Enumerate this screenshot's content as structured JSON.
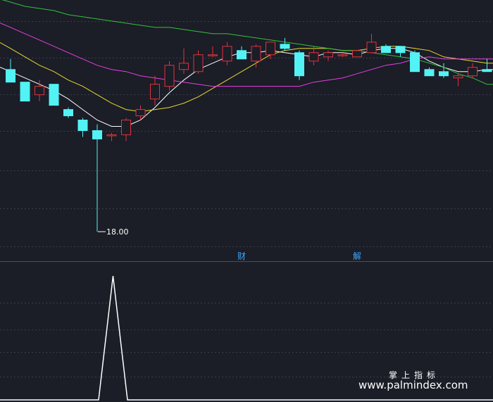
{
  "chart_data": [
    {
      "type": "candlestick",
      "panel": "price",
      "ylim": [
        17.3,
        29.0
      ],
      "grid": true,
      "up_color": "#e0343c",
      "down_color": "#53f2f4",
      "candles": [
        {
          "o": 25.7,
          "h": 26.2,
          "l": 25.1,
          "c": 25.1
        },
        {
          "o": 25.1,
          "h": 25.1,
          "l": 24.2,
          "c": 24.2
        },
        {
          "o": 24.5,
          "h": 25.2,
          "l": 24.2,
          "c": 24.9
        },
        {
          "o": 25.0,
          "h": 25.0,
          "l": 24.0,
          "c": 24.0
        },
        {
          "o": 23.8,
          "h": 23.9,
          "l": 23.4,
          "c": 23.5
        },
        {
          "o": 23.3,
          "h": 23.4,
          "l": 22.5,
          "c": 22.8
        },
        {
          "o": 22.8,
          "h": 23.1,
          "l": 18.0,
          "c": 22.4
        },
        {
          "o": 22.6,
          "h": 22.7,
          "l": 22.3,
          "c": 22.6
        },
        {
          "o": 22.6,
          "h": 23.4,
          "l": 22.3,
          "c": 23.3
        },
        {
          "o": 23.5,
          "h": 24.0,
          "l": 23.3,
          "c": 23.8
        },
        {
          "o": 24.3,
          "h": 25.4,
          "l": 24.0,
          "c": 25.0
        },
        {
          "o": 24.9,
          "h": 26.1,
          "l": 24.7,
          "c": 25.9
        },
        {
          "o": 25.7,
          "h": 26.7,
          "l": 25.5,
          "c": 26.0
        },
        {
          "o": 25.6,
          "h": 26.6,
          "l": 25.5,
          "c": 26.4
        },
        {
          "o": 26.4,
          "h": 26.8,
          "l": 26.3,
          "c": 26.4
        },
        {
          "o": 26.1,
          "h": 27.0,
          "l": 25.9,
          "c": 26.8
        },
        {
          "o": 26.6,
          "h": 26.8,
          "l": 26.2,
          "c": 26.2
        },
        {
          "o": 26.1,
          "h": 26.9,
          "l": 25.8,
          "c": 26.8
        },
        {
          "o": 26.4,
          "h": 27.0,
          "l": 26.2,
          "c": 27.0
        },
        {
          "o": 26.9,
          "h": 27.2,
          "l": 26.6,
          "c": 26.7
        },
        {
          "o": 26.5,
          "h": 26.6,
          "l": 25.2,
          "c": 25.4
        },
        {
          "o": 26.1,
          "h": 26.8,
          "l": 25.9,
          "c": 26.5
        },
        {
          "o": 26.3,
          "h": 26.6,
          "l": 26.1,
          "c": 26.5
        },
        {
          "o": 26.4,
          "h": 26.5,
          "l": 26.3,
          "c": 26.4
        },
        {
          "o": 26.3,
          "h": 26.6,
          "l": 26.3,
          "c": 26.6
        },
        {
          "o": 26.5,
          "h": 27.4,
          "l": 26.5,
          "c": 27.0
        },
        {
          "o": 26.8,
          "h": 26.9,
          "l": 26.5,
          "c": 26.5
        },
        {
          "o": 26.8,
          "h": 26.8,
          "l": 26.3,
          "c": 26.5
        },
        {
          "o": 26.5,
          "h": 26.6,
          "l": 25.6,
          "c": 25.6
        },
        {
          "o": 25.7,
          "h": 25.8,
          "l": 25.4,
          "c": 25.4
        },
        {
          "o": 25.6,
          "h": 26.0,
          "l": 25.3,
          "c": 25.4
        },
        {
          "o": 25.3,
          "h": 25.5,
          "l": 24.9,
          "c": 25.4
        },
        {
          "o": 25.4,
          "h": 26.0,
          "l": 25.3,
          "c": 25.8
        },
        {
          "o": 25.7,
          "h": 26.2,
          "l": 25.6,
          "c": 25.6
        }
      ],
      "ma_lines": [
        {
          "color": "#ffffff",
          "values": [
            25.6,
            25.3,
            25.0,
            24.7,
            24.3,
            23.8,
            23.3,
            23.0,
            23.0,
            23.3,
            23.9,
            24.6,
            25.2,
            25.7,
            26.0,
            26.3,
            26.5,
            26.5,
            26.6,
            26.5,
            26.4,
            26.3,
            26.5,
            26.5,
            26.4,
            26.6,
            26.7,
            26.7,
            26.5,
            26.1,
            25.8,
            25.6,
            25.6,
            25.7
          ]
        },
        {
          "color": "#e8d92f",
          "values": [
            26.7,
            26.3,
            25.9,
            25.6,
            25.2,
            24.9,
            24.5,
            24.1,
            23.8,
            23.7,
            23.8,
            23.9,
            24.1,
            24.4,
            24.8,
            25.2,
            25.6,
            26.0,
            26.4,
            26.6,
            26.7,
            26.7,
            26.7,
            26.6,
            26.6,
            26.7,
            26.8,
            26.8,
            26.7,
            26.6,
            26.3,
            26.2,
            26.1,
            26.0
          ]
        },
        {
          "color": "#e63fe0",
          "values": [
            27.7,
            27.4,
            27.1,
            26.8,
            26.5,
            26.2,
            25.9,
            25.7,
            25.6,
            25.4,
            25.3,
            25.2,
            25.1,
            25.0,
            24.9,
            24.9,
            24.9,
            24.9,
            24.9,
            24.9,
            24.9,
            25.1,
            25.2,
            25.3,
            25.5,
            25.7,
            25.9,
            26.0,
            26.2,
            26.3,
            26.2,
            26.2,
            26.2,
            26.2
          ]
        },
        {
          "color": "#33c23a",
          "values": [
            28.9,
            28.7,
            28.6,
            28.5,
            28.3,
            28.2,
            28.1,
            28.0,
            27.9,
            27.8,
            27.7,
            27.7,
            27.6,
            27.5,
            27.4,
            27.4,
            27.3,
            27.2,
            27.1,
            27.0,
            26.9,
            26.8,
            26.7,
            26.6,
            26.6,
            26.5,
            26.4,
            26.3,
            26.2,
            26.0,
            25.8,
            25.5,
            25.3,
            25.0
          ]
        }
      ],
      "annotations": {
        "low_label": "18.00",
        "low_index": 6,
        "events": [
          {
            "text": "财",
            "index": 16
          },
          {
            "text": "解",
            "index": 24
          }
        ]
      }
    },
    {
      "type": "line",
      "panel": "indicator",
      "ylim": [
        0,
        1
      ],
      "color": "#ffffff",
      "x": [
        0,
        6,
        7,
        8,
        33
      ],
      "values": [
        0,
        0,
        1,
        0,
        0
      ]
    }
  ],
  "watermark": {
    "line1": "掌上指标",
    "line2": "www.palmindex.com"
  }
}
